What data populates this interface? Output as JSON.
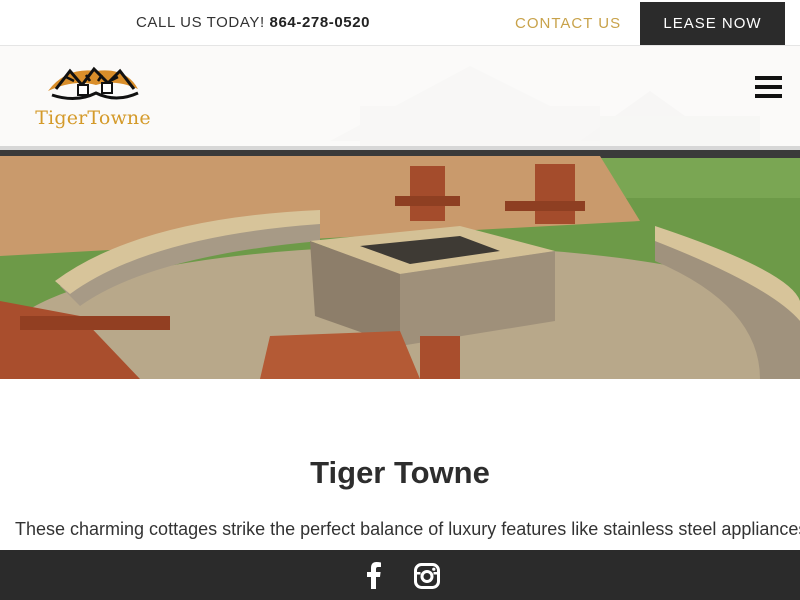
{
  "topbar": {
    "call_label": "CALL US TODAY!",
    "phone": "864-278-0520",
    "contact_label": "CONTACT US",
    "lease_label": "LEASE NOW"
  },
  "brand": {
    "name": "TigerTowne"
  },
  "main": {
    "title": "Tiger Towne",
    "description": "These charming cottages strike the perfect balance of luxury features like stainless steel appliances,"
  },
  "footer": {
    "icons": [
      "facebook-icon",
      "instagram-icon"
    ]
  },
  "colors": {
    "accent": "#c8a24a",
    "dark": "#2b2b2b"
  }
}
